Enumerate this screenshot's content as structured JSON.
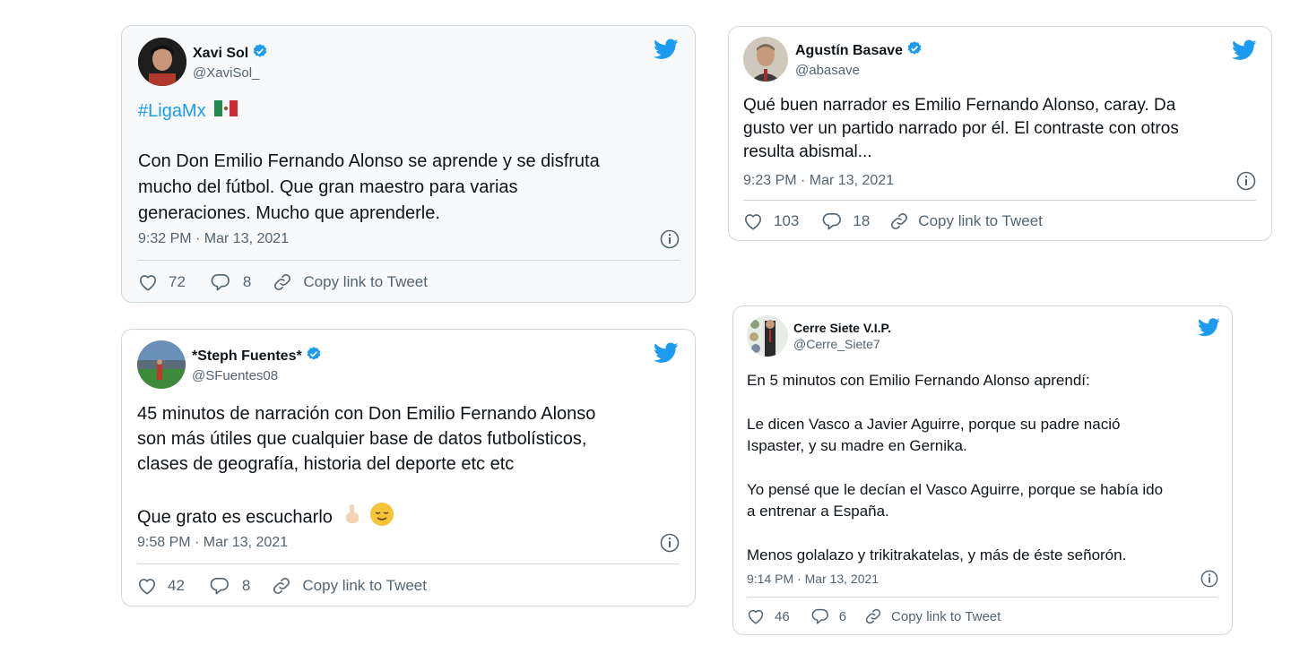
{
  "tweets": [
    {
      "name": "Xavi Sol",
      "handle": "@XaviSol_",
      "hashtag": "#LigaMx",
      "lines": [
        "Con Don Emilio Fernando Alonso se aprende y se disfruta",
        "mucho del fútbol. Que gran maestro para varias",
        "generaciones. Mucho que aprenderle."
      ],
      "time": "9:32 PM · Mar 13, 2021",
      "likes": "72",
      "replies": "8",
      "copy": "Copy link to Tweet"
    },
    {
      "name": "Agustín Basave",
      "handle": "@abasave",
      "lines": [
        "Qué buen narrador es Emilio Fernando Alonso, caray. Da",
        "gusto ver un partido narrado por él. El contraste con otros",
        "resulta abismal..."
      ],
      "time": "9:23 PM · Mar 13, 2021",
      "likes": "103",
      "replies": "18",
      "copy": "Copy link to Tweet"
    },
    {
      "name": "*Steph Fuentes*",
      "handle": "@SFuentes08",
      "lines": [
        "45 minutos de narración con Don Emilio Fernando Alonso",
        "son más útiles que cualquier base de datos futbolísticos,",
        "clases de geografía, historia del deporte etc etc"
      ],
      "last_line": "Que grato es escucharlo",
      "time": "9:58 PM · Mar 13, 2021",
      "likes": "42",
      "replies": "8",
      "copy": "Copy link to Tweet"
    },
    {
      "name": "Cerre Siete V.I.P.",
      "handle": "@Cerre_Siete7",
      "lines": [
        "En 5 minutos con Emilio Fernando Alonso aprendí:",
        "Le dicen Vasco a Javier Aguirre, porque su padre nació",
        "Ispaster, y su madre en Gernika.",
        "Yo pensé que le decían el Vasco Aguirre, porque se había ido",
        "a entrenar a España.",
        "Menos golalazo y trikitrakatelas, y más de éste señorón."
      ],
      "time": "9:14 PM · Mar 13, 2021",
      "likes": "46",
      "replies": "6",
      "copy": "Copy link to Tweet"
    }
  ],
  "icons": {
    "bird": "twitter-bird-icon",
    "verified": "verified-badge-icon",
    "info": "info-icon",
    "heart": "heart-icon",
    "reply": "reply-icon",
    "link": "link-icon"
  },
  "colors": {
    "twitter_blue": "#1d9bf0",
    "muted": "#536471",
    "border": "#cfd9de",
    "text": "#0f1419"
  }
}
